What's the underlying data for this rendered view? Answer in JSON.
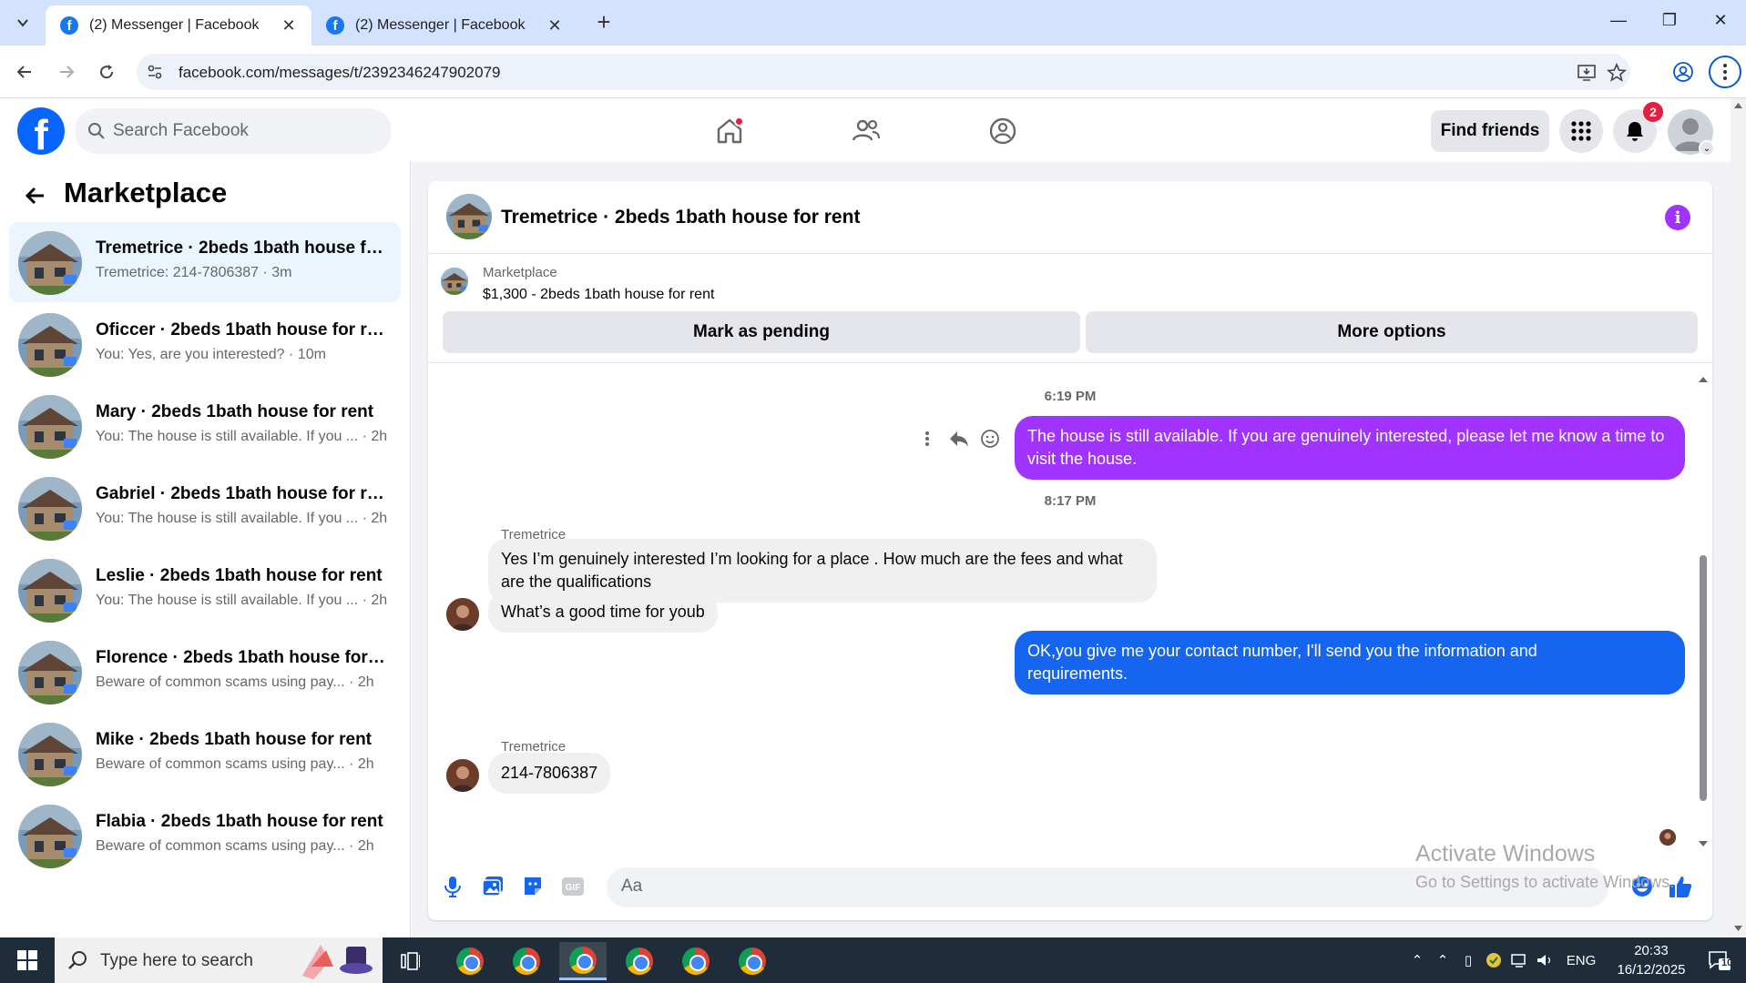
{
  "browser": {
    "tabs": [
      {
        "title": "(2) Messenger | Facebook",
        "active": true
      },
      {
        "title": "(2) Messenger | Facebook",
        "active": false
      }
    ],
    "url": "facebook.com/messages/t/2392346247902079"
  },
  "header": {
    "search_placeholder": "Search Facebook",
    "find_friends": "Find friends",
    "notification_count": "2"
  },
  "sidebar": {
    "title": "Marketplace",
    "conversations": [
      {
        "name": "Tremetrice · 2beds 1bath house for...",
        "preview": "Tremetrice: 214-7806387 · 3m",
        "selected": true
      },
      {
        "name": "Oficcer · 2beds 1bath house for rent",
        "preview": "You: Yes, are you interested? · 10m",
        "selected": false
      },
      {
        "name": "Mary · 2beds 1bath house for rent",
        "preview": "You: The house is still available. If you ... · 2h",
        "selected": false
      },
      {
        "name": "Gabriel · 2beds 1bath house for rent",
        "preview": "You: The house is still available. If you ... · 2h",
        "selected": false
      },
      {
        "name": "Leslie · 2beds 1bath house for rent",
        "preview": "You: The house is still available. If you ... · 2h",
        "selected": false
      },
      {
        "name": "Florence · 2beds 1bath house for r...",
        "preview": "Beware of common scams using pay... · 2h",
        "selected": false
      },
      {
        "name": "Mike · 2beds 1bath house for rent",
        "preview": "Beware of common scams using pay... · 2h",
        "selected": false
      },
      {
        "name": "Flabia · 2beds 1bath house for rent",
        "preview": "Beware of common scams using pay... · 2h",
        "selected": false
      }
    ]
  },
  "chat": {
    "title": "Tremetrice · 2beds 1bath house for rent",
    "listing_source": "Marketplace",
    "listing_price": "$1,300 - 2beds 1bath house for rent",
    "mark_pending": "Mark as pending",
    "more_options": "More options",
    "time1": "6:19 PM",
    "msg1": "The house is still available. If you are genuinely interested, please let me know a time to visit the house.",
    "time2": "8:17 PM",
    "sender": "Tremetrice",
    "msg2": "Yes I’m genuinely interested I’m looking for a place . How much are the fees and what are the qualifications",
    "msg3": "What’s a good time for youb",
    "msg4": "OK,you give me your contact number, I'll send you the information and requirements.",
    "msg5": "214-7806387",
    "composer_placeholder": "Aa"
  },
  "watermark": {
    "line1": "Activate Windows",
    "line2": "Go to Settings to activate Windows."
  },
  "taskbar": {
    "search_placeholder": "Type here to search",
    "lang": "ENG",
    "time": "20:33",
    "date": "16/12/2025",
    "notif": "10"
  },
  "colors": {
    "fb_blue": "#0866ff",
    "purple_bubble": "#a033ff",
    "blue_bubble": "#1565f0",
    "selected_row": "#ebf5ff"
  }
}
